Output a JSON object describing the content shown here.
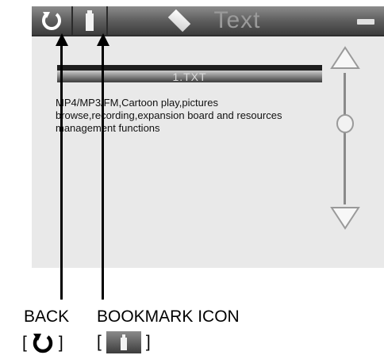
{
  "window": {
    "title": "Text"
  },
  "toolbar": {
    "back_icon": "refresh-arrow-icon",
    "bookmark_icon": "bookmark-icon",
    "title_icon": "diamond-icon",
    "minimize_icon": "minus-icon"
  },
  "document": {
    "file_name": "1.TXT",
    "text": "MP4/MP3/FM,Cartoon play,pictures browse,recording,expansion board and resources management functions"
  },
  "scrollbar": {
    "up_icon": "triangle-up-icon",
    "down_icon": "triangle-down-icon",
    "thumb_icon": "circle-icon"
  },
  "callouts": {
    "back": {
      "label": "BACK",
      "bracket_open": "[",
      "bracket_close": "]"
    },
    "bookmark": {
      "label": "BOOKMARK ICON",
      "bracket_open": "[",
      "bracket_close": "]"
    }
  },
  "colors": {
    "titlebar": "#5e5e5e",
    "screen_bg": "#e9e9e9",
    "arrow": "#000000"
  }
}
